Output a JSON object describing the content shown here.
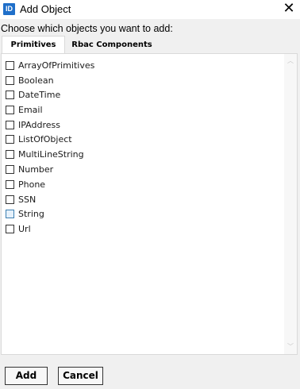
{
  "window": {
    "app_icon_text": "ID",
    "title": "Add Object",
    "close_glyph": "✕"
  },
  "prompt": "Choose which objects you want to add:",
  "tabs": [
    {
      "label": "Primitives",
      "active": true
    },
    {
      "label": "Rbac Components",
      "active": false
    }
  ],
  "items": [
    {
      "label": "ArrayOfPrimitives",
      "checked": false
    },
    {
      "label": "Boolean",
      "checked": false
    },
    {
      "label": "DateTime",
      "checked": false
    },
    {
      "label": "Email",
      "checked": false
    },
    {
      "label": "IPAddress",
      "checked": false
    },
    {
      "label": "ListOfObject",
      "checked": false
    },
    {
      "label": "MultiLineString",
      "checked": false
    },
    {
      "label": "Number",
      "checked": false
    },
    {
      "label": "Phone",
      "checked": false
    },
    {
      "label": "SSN",
      "checked": false
    },
    {
      "label": "String",
      "checked": false,
      "hovered": true
    },
    {
      "label": "Url",
      "checked": false
    }
  ],
  "scrollbar": {
    "up_glyph": "︿",
    "down_glyph": "﹀"
  },
  "buttons": {
    "add": "Add",
    "cancel": "Cancel"
  }
}
